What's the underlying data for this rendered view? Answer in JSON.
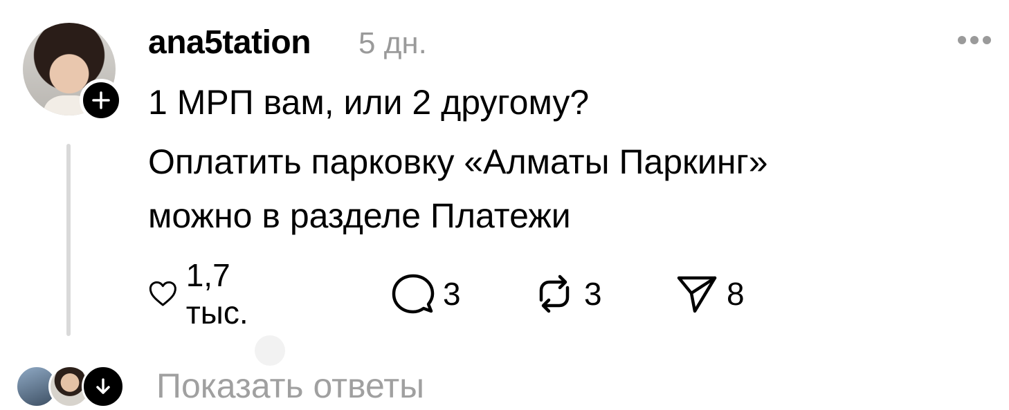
{
  "post": {
    "username": "ana5tation",
    "time": "5 дн.",
    "lines": [
      "1 МРП вам, или 2 другому?",
      "Оплатить парковку «Алматы Паркинг»",
      "можно в разделе Платежи"
    ]
  },
  "actions": {
    "likes": "1,7 тыс.",
    "comments": "3",
    "reposts": "3",
    "shares": "8"
  },
  "replies": {
    "label": "Показать ответы"
  },
  "icons": {
    "follow": "plus-icon",
    "more": "more-horizontal-icon",
    "like": "heart-icon",
    "comment": "comment-bubble-icon",
    "repost": "repost-icon",
    "share": "send-icon",
    "expand": "arrow-down-icon"
  },
  "colors": {
    "text": "#000000",
    "muted": "#9a9a9a",
    "thread_line": "#d9d9d9",
    "badge": "#000000"
  }
}
